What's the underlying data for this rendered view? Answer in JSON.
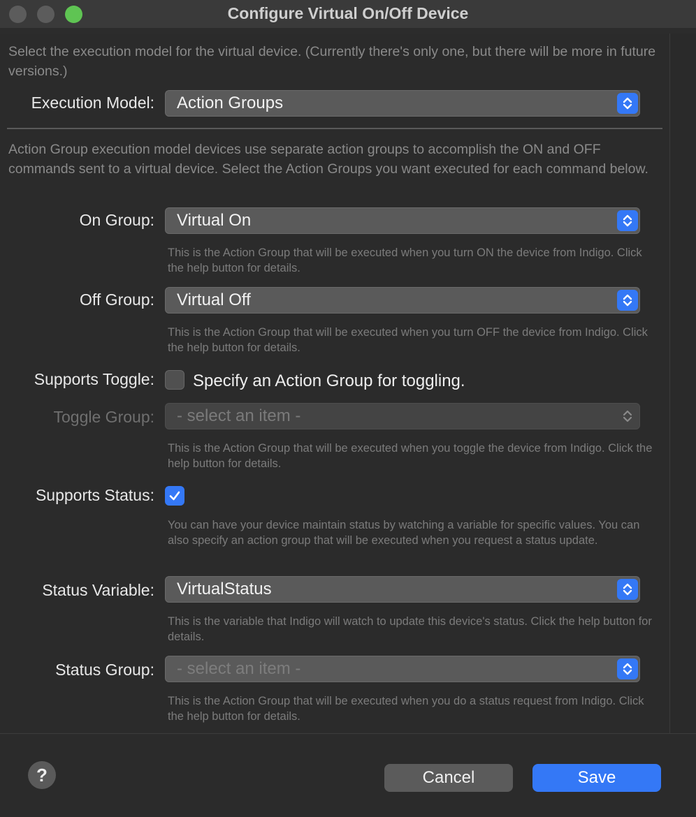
{
  "window": {
    "title": "Configure Virtual On/Off Device"
  },
  "intro_text": "Select the execution model for the virtual device. (Currently there's only one, but there will be more in future versions.)",
  "execution_model": {
    "label": "Execution Model:",
    "value": "Action Groups"
  },
  "action_group_text": "Action Group execution model devices use separate action groups to accomplish the ON and OFF commands sent to a virtual device. Select the Action Groups you want executed for each command below.",
  "on_group": {
    "label": "On Group:",
    "value": "Virtual On",
    "help": "This is the Action Group that will be executed when you turn ON the device from Indigo. Click the help button for details."
  },
  "off_group": {
    "label": "Off Group:",
    "value": "Virtual Off",
    "help": "This is the Action Group that will be executed when you turn OFF the device from Indigo. Click the help button for details."
  },
  "supports_toggle": {
    "label": "Supports Toggle:",
    "checkbox_label": "Specify an Action Group for toggling.",
    "checked": false
  },
  "toggle_group": {
    "label": "Toggle Group:",
    "value": "- select an item -",
    "help": "This is the Action Group that will be executed when you toggle the device from Indigo. Click the help button for details."
  },
  "supports_status": {
    "label": "Supports Status:",
    "checked": true,
    "help": "You can have your device maintain status by watching a variable for specific values. You can also specify an action group that will be executed when you request a status update."
  },
  "status_variable": {
    "label": "Status Variable:",
    "value": "VirtualStatus",
    "help": "This is the variable that Indigo will watch to update this device's status. Click the help button for details."
  },
  "status_group": {
    "label": "Status Group:",
    "value": "- select an item -",
    "help": "This is the Action Group that will be executed when you do a status request from Indigo. Click the help button for details."
  },
  "footer": {
    "help_button": "?",
    "cancel_label": "Cancel",
    "save_label": "Save"
  },
  "colors": {
    "accent": "#3478f6",
    "zoom_button": "#5fc453"
  }
}
